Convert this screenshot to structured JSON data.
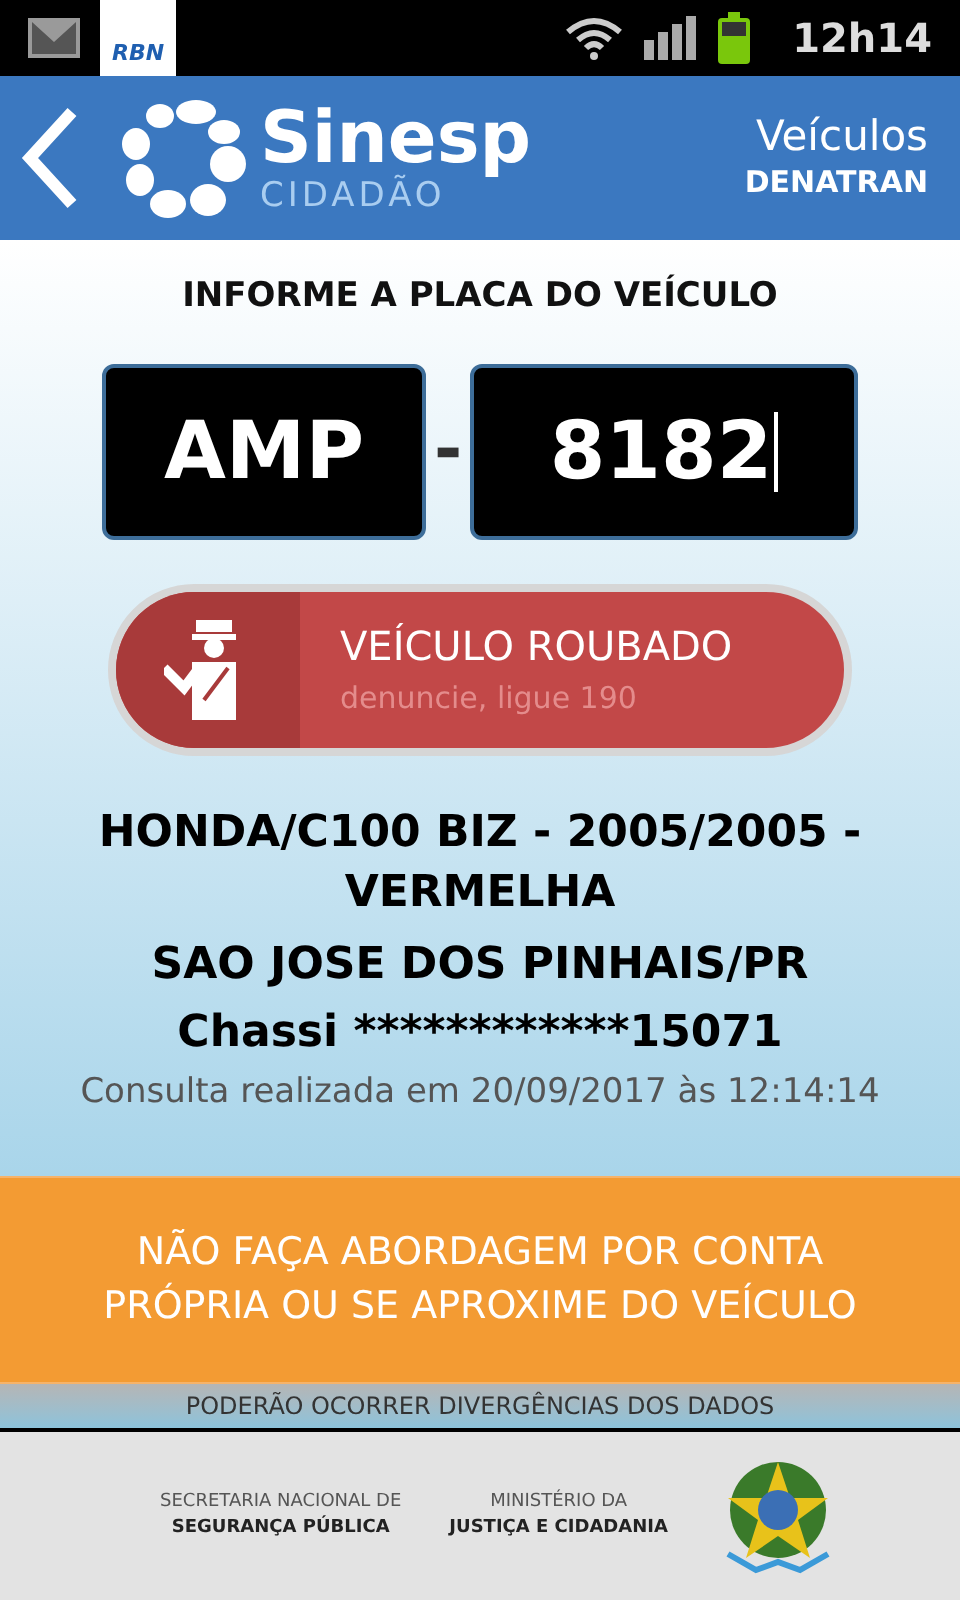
{
  "status_bar": {
    "notification_app": "RBN",
    "time": "12h14"
  },
  "header": {
    "brand": "Sinesp",
    "sub_brand": "CIDADÃO",
    "section": "Veículos",
    "agency": "DENATRAN"
  },
  "form": {
    "title": "INFORME A PLACA DO VEÍCULO",
    "plate_letters": "AMP",
    "separator": "-",
    "plate_numbers": "8182"
  },
  "alert_button": {
    "title": "VEÍCULO ROUBADO",
    "subtitle": "denuncie, ligue 190"
  },
  "vehicle": {
    "model": "HONDA/C100 BIZ - 2005/2005 - VERMELHA",
    "city": "SAO JOSE DOS PINHAIS/PR",
    "chassis": "Chassi ************15071",
    "query_time": "Consulta realizada em 20/09/2017 às 12:14:14"
  },
  "warning": "NÃO FAÇA ABORDAGEM POR CONTA PRÓPRIA OU SE APROXIME DO VEÍCULO",
  "disclaimer": "PODERÃO OCORRER DIVERGÊNCIAS DOS DADOS",
  "footer": [
    {
      "line1": "SECRETARIA NACIONAL DE",
      "line2": "SEGURANÇA PÚBLICA"
    },
    {
      "line1": "MINISTÉRIO DA",
      "line2": "JUSTIÇA E CIDADANIA"
    }
  ]
}
